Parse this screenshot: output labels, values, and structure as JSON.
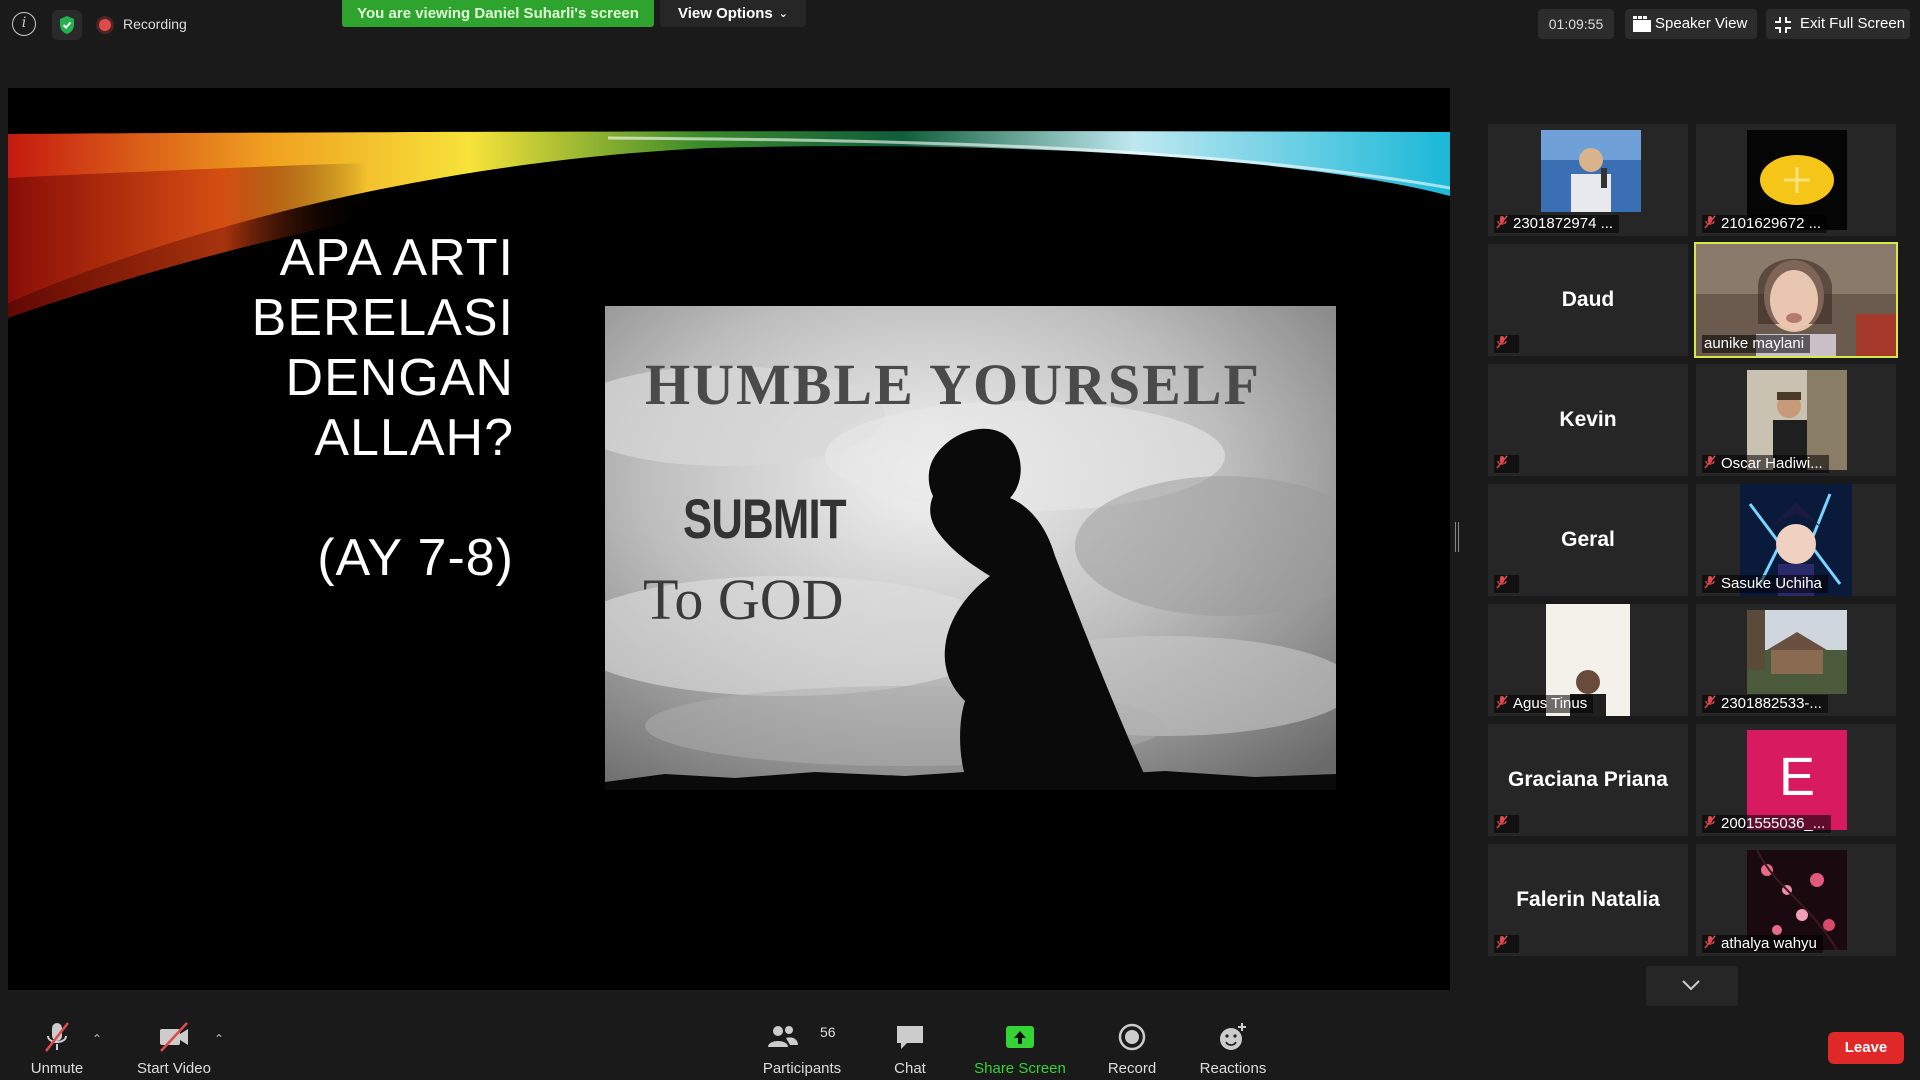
{
  "topbar": {
    "recording_label": "Recording",
    "viewing_banner": "You are viewing Daniel Suharli's screen",
    "view_options_label": "View Options",
    "timer": "01:09:55",
    "speaker_view_label": "Speaker View",
    "exit_fullscreen_label": "Exit Full Screen"
  },
  "slide": {
    "title_lines": [
      "APA ARTI",
      "BERELASI",
      "DENGAN",
      "ALLAH?"
    ],
    "subtitle": "(AY 7-8)",
    "image_text_1": "HUMBLE  YOURSELF",
    "image_text_2": "SUBMIT",
    "image_text_3": "To GOD"
  },
  "gallery": {
    "tiles": [
      {
        "name": "2301872974 ...",
        "type": "video",
        "muted": true
      },
      {
        "name": "2101629672 ...",
        "type": "video",
        "muted": true
      },
      {
        "name": "Daud",
        "type": "name",
        "muted": true
      },
      {
        "name": "aunike maylani",
        "type": "video",
        "muted": false,
        "active": true
      },
      {
        "name": "Kevin",
        "type": "name",
        "muted": true
      },
      {
        "name": "Oscar Hadiwi...",
        "type": "video",
        "muted": true
      },
      {
        "name": "Geral",
        "type": "name",
        "muted": true
      },
      {
        "name": "Sasuke Uchiha",
        "type": "video",
        "muted": true
      },
      {
        "name": "Agus Tinus",
        "type": "video",
        "muted": true
      },
      {
        "name": "2301882533-...",
        "type": "video",
        "muted": true
      },
      {
        "name": "Graciana Priana",
        "type": "name",
        "muted": true
      },
      {
        "name": "2001555036_...",
        "type": "video",
        "muted": true,
        "avatar_letter": "E"
      },
      {
        "name": "Falerin Natalia",
        "type": "name",
        "muted": true
      },
      {
        "name": "athalya wahyu",
        "type": "video",
        "muted": true
      }
    ]
  },
  "toolbar": {
    "unmute_label": "Unmute",
    "start_video_label": "Start Video",
    "participants_label": "Participants",
    "participants_count": "56",
    "chat_label": "Chat",
    "share_screen_label": "Share Screen",
    "record_label": "Record",
    "reactions_label": "Reactions",
    "leave_label": "Leave"
  },
  "colors": {
    "share_green": "#2ea32e",
    "leave_red": "#e02828",
    "active_speaker": "#d6e84a",
    "mute_red": "#e04a4a"
  }
}
